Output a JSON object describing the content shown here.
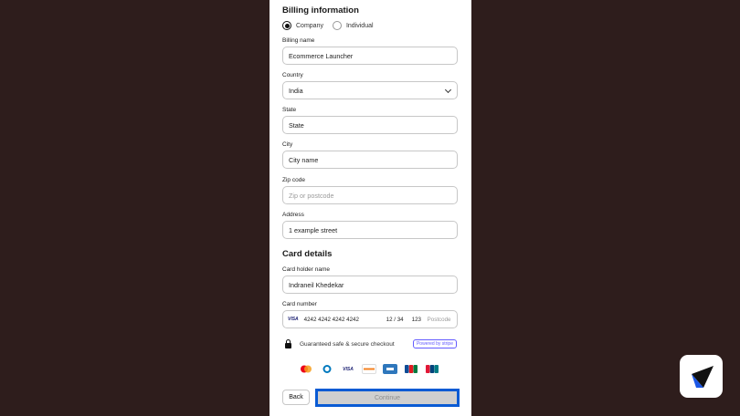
{
  "billing": {
    "title": "Billing information",
    "radio_company": "Company",
    "radio_individual": "Individual",
    "name_label": "Billing name",
    "name_value": "Ecommerce Launcher",
    "country_label": "Country",
    "country_value": "India",
    "state_label": "State",
    "state_value": "State",
    "city_label": "City",
    "city_value": "City name",
    "zip_label": "Zip code",
    "zip_placeholder": "Zip or postcode",
    "address_label": "Address",
    "address_value": "1 example street"
  },
  "card": {
    "title": "Card details",
    "holder_label": "Card holder name",
    "holder_value": "Indraneil Khedekar",
    "number_label": "Card number",
    "brand_mini": "VISA",
    "number_value": "4242 4242 4242 4242",
    "expiry": "12 / 34",
    "cvc": "123",
    "postcode_placeholder": "Postcode"
  },
  "secure": {
    "text": "Guaranteed safe & secure checkout",
    "powered": "Powered by stripe"
  },
  "brands": [
    "mastercard",
    "diners",
    "VISA",
    "discover",
    "amex",
    "jcb",
    "unionpay"
  ],
  "brand_text": {
    "visa": "VISA"
  },
  "actions": {
    "back": "Back",
    "continue": "Continue"
  },
  "colors": {
    "background": "#2e1d1c",
    "highlight": "#0a5bd4",
    "stripe": "#635bff"
  }
}
